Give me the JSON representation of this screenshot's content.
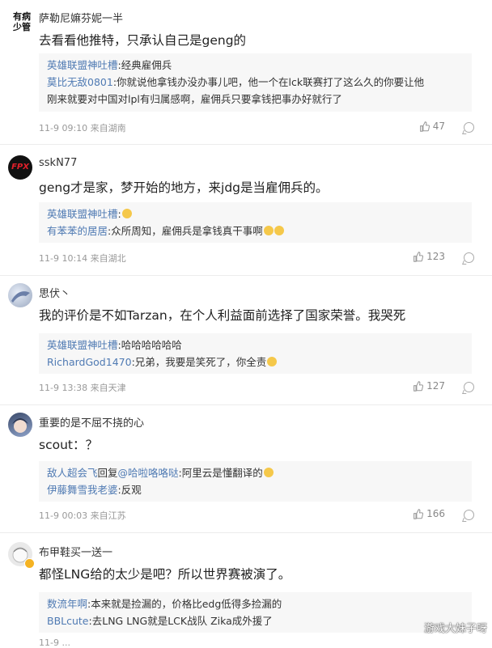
{
  "comments": [
    {
      "username": "萨勒尼嫲芬妮一半",
      "text": "去看看他推特，只承认自己是geng的",
      "avatar": {
        "type": "text",
        "lines": [
          "有病",
          "少管"
        ]
      },
      "replies": [
        {
          "name": "英雄联盟神吐槽",
          "text": ":经典雇佣兵"
        },
        {
          "name": "莫比无敌0801",
          "text": ":你就说他拿钱办没办事儿吧，他一个在lck联赛打了这么久的你要让他"
        },
        {
          "name": "",
          "text": "刚来就要对中国对lpl有归属感啊，雇佣兵只要拿钱把事办好就行了"
        }
      ],
      "time": "11-9 09:10 来自湖南",
      "likes": "47"
    },
    {
      "username": "sskN77",
      "text": "geng才是家，梦开始的地方，来jdg是当雇佣兵的。",
      "avatar": {
        "type": "logo",
        "lines": [
          "FPX"
        ]
      },
      "replies": [
        {
          "name": "英雄联盟神吐槽",
          "text": ":",
          "emoji": true
        },
        {
          "name": "有苯苯的居居",
          "text": ":众所周知，雇佣兵是拿钱真干事啊",
          "emoji2": true
        }
      ],
      "time": "11-9 10:14 来自湖北",
      "likes": "123"
    },
    {
      "username": "思伏丶",
      "text": "我的评价是不如Tarzan，在个人利益面前选择了国家荣誉。我哭死",
      "avatar": {
        "type": "art",
        "lines": []
      },
      "replies": [
        {
          "name": "英雄联盟神吐槽",
          "text": ":哈哈哈哈哈哈"
        },
        {
          "name": "RichardGod1470",
          "text": ":兄弟，我要是笑死了，你全责",
          "emoji": true
        }
      ],
      "time": "11-9 13:38 来自天津",
      "likes": "127"
    },
    {
      "username": "重要的是不屈不挠的心",
      "text": "scout：？",
      "avatar": {
        "type": "anime",
        "lines": []
      },
      "replies": [
        {
          "name": "敌人超会飞",
          "text": "回复",
          "mention": "@哈啦咯咯哒",
          "tail": ":阿里云是懂翻译的",
          "emoji": true
        },
        {
          "name": "伊藤舞雪我老婆",
          "text": ":反观"
        }
      ],
      "time": "11-9 00:03 来自江苏",
      "likes": "166"
    },
    {
      "username": "布甲鞋买一送一",
      "text": "都怪LNG给的太少是吧？所以世界赛被演了。",
      "avatar": {
        "type": "anime2",
        "lines": []
      },
      "replies": [
        {
          "name": "数流年啊",
          "text": ":本来就是捡漏的，价格比edg低得多捡漏的"
        },
        {
          "name": "BBLcute",
          "text": ":去LNG LNG就是LCK战队 Zika成外援了"
        }
      ],
      "time": "11-9 ...",
      "likes": ""
    }
  ],
  "watermark": "游戏大妹子呀",
  "colors": {
    "link": "#4f7ab3",
    "quote_bg": "#f7f7f7",
    "meta": "#999999"
  }
}
